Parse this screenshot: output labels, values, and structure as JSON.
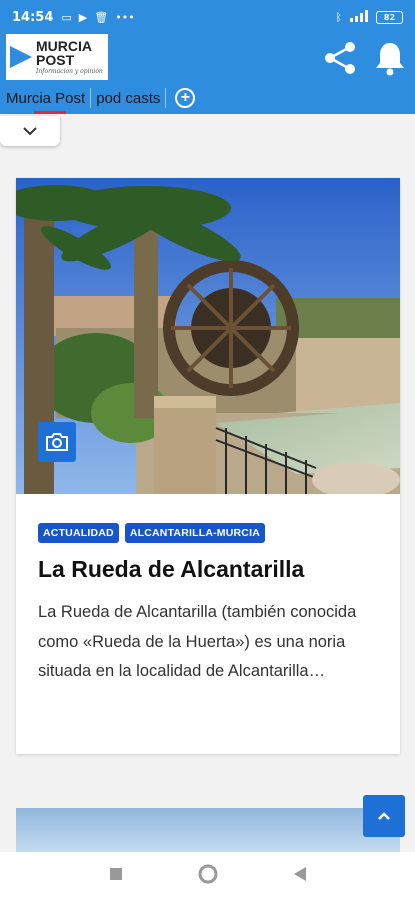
{
  "status_bar": {
    "time": "14:54",
    "battery": "82"
  },
  "header": {
    "logo_line1": "MURCIA",
    "logo_line2": "POST",
    "logo_tagline": "Información y opinión",
    "brand_color": "#2f8ddf"
  },
  "tabs": [
    {
      "label": "Murcia Post"
    },
    {
      "label": "pod casts"
    }
  ],
  "article": {
    "tags": [
      "ACTUALIDAD",
      "ALCANTARILLA-MURCIA"
    ],
    "title": "La Rueda de Alcantarilla",
    "excerpt": "La Rueda de Alcantarilla (también conocida como «Rueda de la Huerta») es una noria situada en la localidad de Alcantarilla…"
  },
  "icons": {
    "share": "share-icon",
    "bell": "bell-icon",
    "camera": "camera-icon",
    "scroll_top": "chevron-up-icon",
    "collapse": "chevron-down-icon"
  }
}
